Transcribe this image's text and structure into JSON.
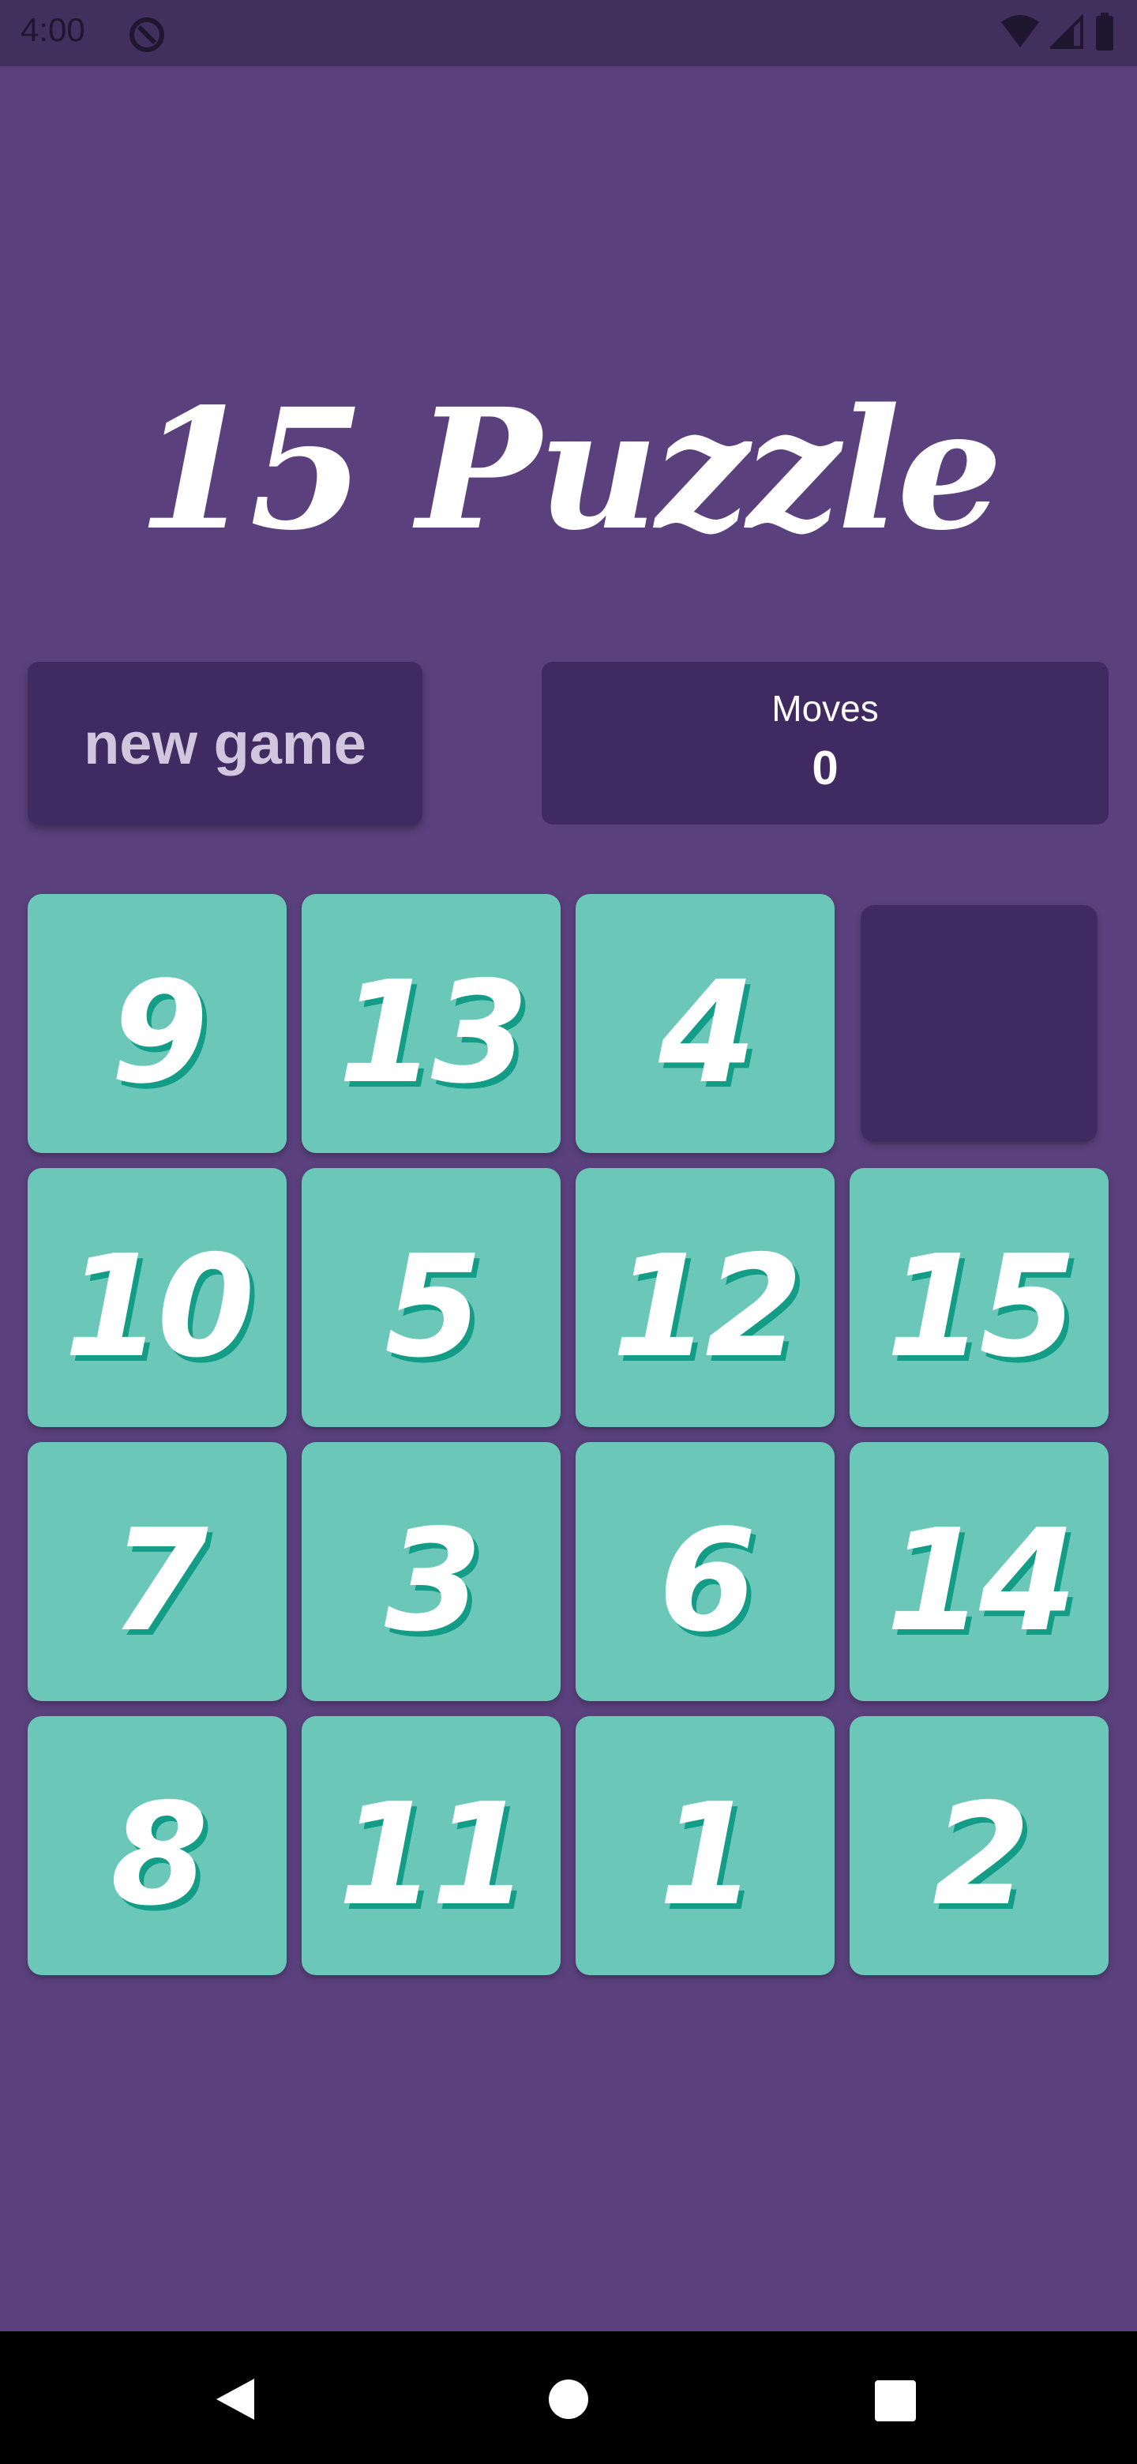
{
  "status_bar": {
    "time": "4:00"
  },
  "title": "15 Puzzle",
  "controls": {
    "new_game_label": "new game",
    "moves_label": "Moves",
    "moves_value": "0"
  },
  "board": {
    "rows": [
      [
        "9",
        "13",
        "4",
        ""
      ],
      [
        "10",
        "5",
        "12",
        "15"
      ],
      [
        "7",
        "3",
        "6",
        "14"
      ],
      [
        "8",
        "11",
        "1",
        "2"
      ]
    ]
  },
  "colors": {
    "background": "#5a417d",
    "panel": "#3f2a62",
    "tile": "#6bc8b9",
    "tile_shadow": "#139c86"
  }
}
